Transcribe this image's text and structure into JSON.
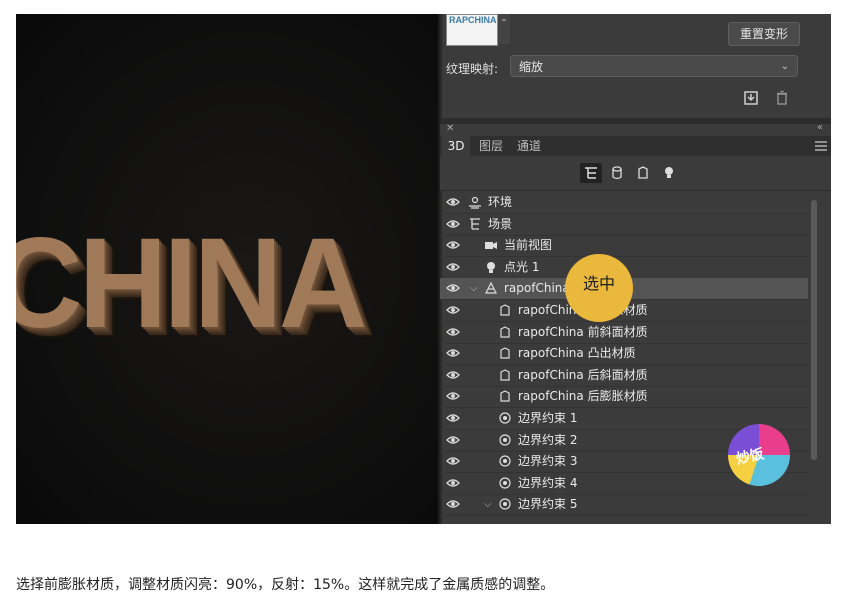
{
  "canvas": {
    "text3d": "CHINA"
  },
  "panel": {
    "thumb_text": "RAPCHINA",
    "reset_button": "重置变形",
    "texture_label": "纹理映射:",
    "texture_value": "缩放",
    "tabs": [
      {
        "label": "3D",
        "active": true
      },
      {
        "label": "图层",
        "active": false
      },
      {
        "label": "通道",
        "active": false
      }
    ],
    "tree": [
      {
        "label": "环境",
        "indent": 0,
        "icon": "environment-icon"
      },
      {
        "label": "场景",
        "indent": 0,
        "icon": "scene-icon"
      },
      {
        "label": "当前视图",
        "indent": 1,
        "icon": "camera-icon"
      },
      {
        "label": "点光 1",
        "indent": 1,
        "icon": "light-bulb-icon"
      },
      {
        "label": "rapofChina",
        "indent": 1,
        "icon": "mesh-icon",
        "selected": true
      },
      {
        "label": "rapofChina 前膨胀材质",
        "indent": 2,
        "icon": "material-icon"
      },
      {
        "label": "rapofChina 前斜面材质",
        "indent": 2,
        "icon": "material-icon"
      },
      {
        "label": "rapofChina 凸出材质",
        "indent": 2,
        "icon": "material-icon"
      },
      {
        "label": "rapofChina 后斜面材质",
        "indent": 2,
        "icon": "material-icon"
      },
      {
        "label": "rapofChina 后膨胀材质",
        "indent": 2,
        "icon": "material-icon"
      },
      {
        "label": "边界约束 1",
        "indent": 2,
        "icon": "constraint-icon"
      },
      {
        "label": "边界约束 2",
        "indent": 2,
        "icon": "constraint-icon"
      },
      {
        "label": "边界约束 3",
        "indent": 2,
        "icon": "constraint-icon"
      },
      {
        "label": "边界约束 4",
        "indent": 2,
        "icon": "constraint-icon"
      },
      {
        "label": "边界约束 5",
        "indent": 2,
        "icon": "constraint-icon"
      }
    ]
  },
  "badge": {
    "text": "选中",
    "color": "#e9b83c"
  },
  "caption": "选择前膨胀材质，调整材质闪亮：90%，反射：15%。这样就完成了金属质感的调整。"
}
